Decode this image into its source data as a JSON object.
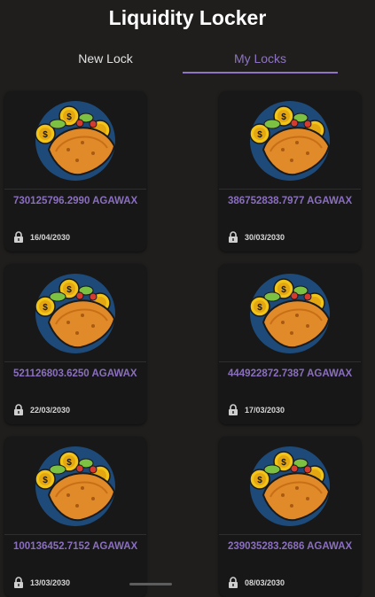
{
  "app": {
    "title": "Liquidity Locker"
  },
  "tabs": [
    {
      "label": "New Lock",
      "active": false
    },
    {
      "label": "My Locks",
      "active": true
    }
  ],
  "accent_color": "#8e74c2",
  "card_icon": "taco-coin-logo",
  "lock_icon": "padlock-icon",
  "locks": [
    {
      "amount": "730125796.2990 AGAWAX",
      "date": "16/04/2030"
    },
    {
      "amount": "386752838.7977 AGAWAX",
      "date": "30/03/2030"
    },
    {
      "amount": "521126803.6250 AGAWAX",
      "date": "22/03/2030"
    },
    {
      "amount": "444922872.7387 AGAWAX",
      "date": "17/03/2030"
    },
    {
      "amount": "100136452.7152 AGAWAX",
      "date": "13/03/2030"
    },
    {
      "amount": "239035283.2686 AGAWAX",
      "date": "08/03/2030"
    }
  ]
}
